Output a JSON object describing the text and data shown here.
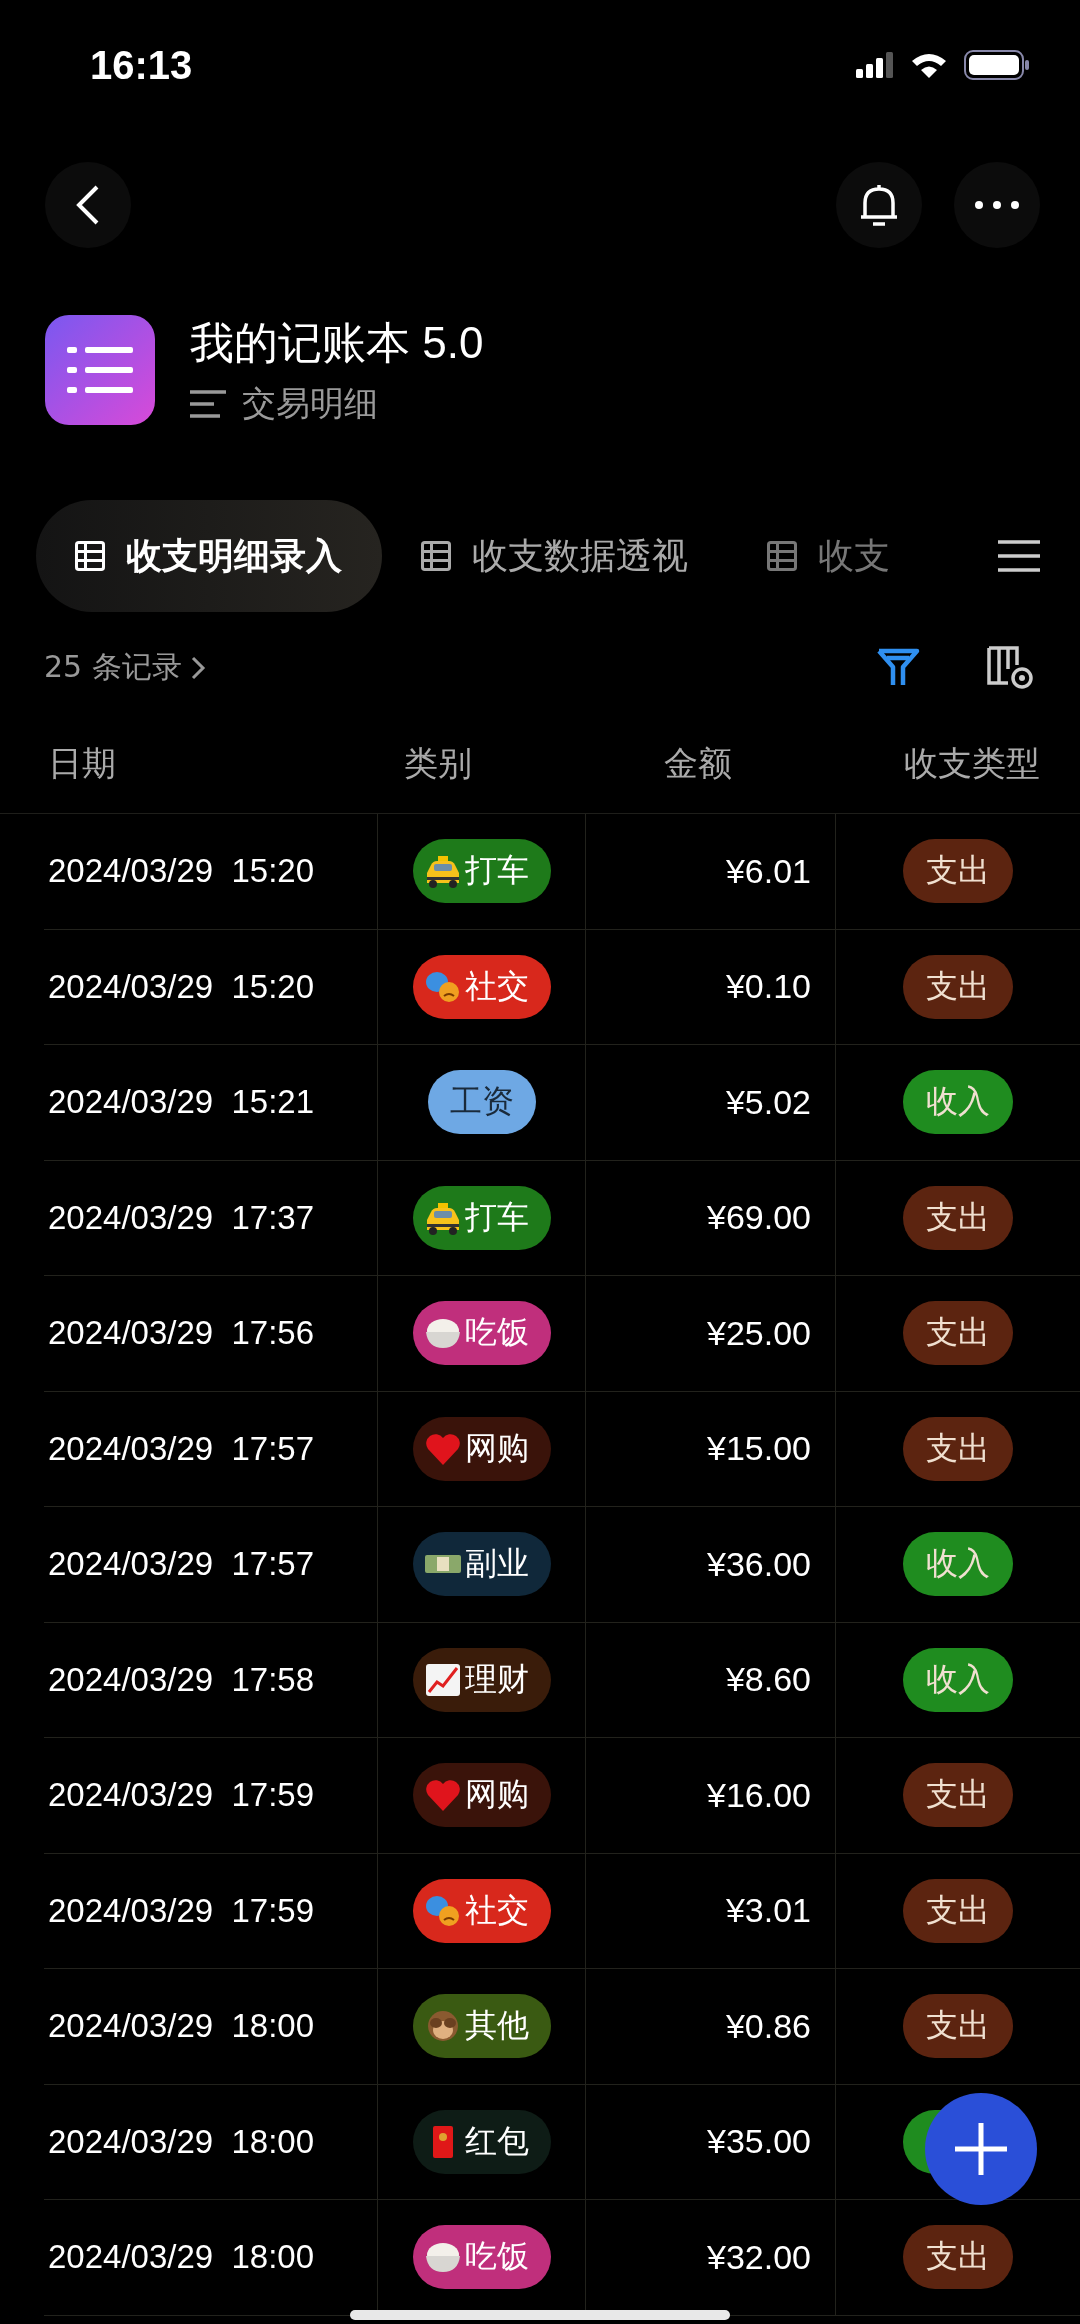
{
  "status_bar": {
    "time": "16:13"
  },
  "header": {
    "title": "我的记账本 5.0",
    "subtitle": "交易明细"
  },
  "tabs": [
    {
      "label": "收支明细录入",
      "selected": true
    },
    {
      "label": "收支数据透视",
      "selected": false
    },
    {
      "label": "收支",
      "selected": false
    }
  ],
  "records": {
    "count": "25 条记录"
  },
  "table": {
    "columns": [
      "日期",
      "类别",
      "金额",
      "收支类型"
    ],
    "rows": [
      {
        "date": "2024/03/29  15:20",
        "category": {
          "label": "打车",
          "kind": "taxi",
          "color": "#1e7a1a"
        },
        "amount": "¥6.01",
        "type": {
          "label": "支出",
          "kind": "expense"
        }
      },
      {
        "date": "2024/03/29  15:20",
        "category": {
          "label": "社交",
          "kind": "masks",
          "color": "#d8281c"
        },
        "amount": "¥0.10",
        "type": {
          "label": "支出",
          "kind": "expense"
        }
      },
      {
        "date": "2024/03/29  15:21",
        "category": {
          "label": "工资",
          "kind": "plain",
          "color": "#6ea8e4"
        },
        "amount": "¥5.02",
        "type": {
          "label": "收入",
          "kind": "income"
        }
      },
      {
        "date": "2024/03/29  17:37",
        "category": {
          "label": "打车",
          "kind": "taxi",
          "color": "#1e7a1a"
        },
        "amount": "¥69.00",
        "type": {
          "label": "支出",
          "kind": "expense"
        }
      },
      {
        "date": "2024/03/29  17:56",
        "category": {
          "label": "吃饭",
          "kind": "rice",
          "color": "#c02f7c"
        },
        "amount": "¥25.00",
        "type": {
          "label": "支出",
          "kind": "expense"
        }
      },
      {
        "date": "2024/03/29  17:57",
        "category": {
          "label": "网购",
          "kind": "heart",
          "color": "#3a130a"
        },
        "amount": "¥15.00",
        "type": {
          "label": "支出",
          "kind": "expense"
        }
      },
      {
        "date": "2024/03/29  17:57",
        "category": {
          "label": "副业",
          "kind": "money",
          "color": "#10283a"
        },
        "amount": "¥36.00",
        "type": {
          "label": "收入",
          "kind": "income"
        }
      },
      {
        "date": "2024/03/29  17:58",
        "category": {
          "label": "理财",
          "kind": "chart",
          "color": "#3a1c0a"
        },
        "amount": "¥8.60",
        "type": {
          "label": "收入",
          "kind": "income"
        }
      },
      {
        "date": "2024/03/29  17:59",
        "category": {
          "label": "网购",
          "kind": "heart",
          "color": "#3a130a"
        },
        "amount": "¥16.00",
        "type": {
          "label": "支出",
          "kind": "expense"
        }
      },
      {
        "date": "2024/03/29  17:59",
        "category": {
          "label": "社交",
          "kind": "masks",
          "color": "#d8281c"
        },
        "amount": "¥3.01",
        "type": {
          "label": "支出",
          "kind": "expense"
        }
      },
      {
        "date": "2024/03/29  18:00",
        "category": {
          "label": "其他",
          "kind": "monkey",
          "color": "#3a5a12"
        },
        "amount": "¥0.86",
        "type": {
          "label": "支出",
          "kind": "expense"
        }
      },
      {
        "date": "2024/03/29  18:00",
        "category": {
          "label": "红包",
          "kind": "envelope",
          "color": "#0e1c16"
        },
        "amount": "¥35.00",
        "type": {
          "kind": "income"
        }
      },
      {
        "date": "2024/03/29  18:00",
        "category": {
          "label": "吃饭",
          "kind": "rice",
          "color": "#c02f7c"
        },
        "amount": "¥32.00",
        "type": {
          "label": "支出",
          "kind": "expense"
        }
      }
    ]
  }
}
